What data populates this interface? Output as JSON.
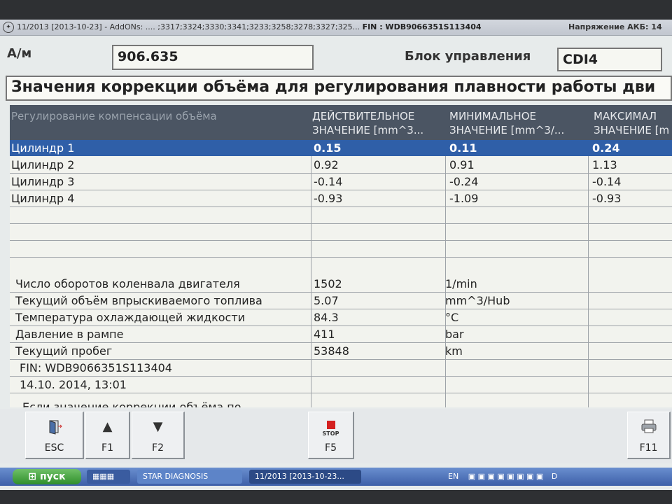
{
  "titlebar": {
    "app_info": "11/2013 [2013-10-23] - AddONs: .... ;3317;3324;3330;3341;3233;3258;3278;3327;325...",
    "fin": "FIN : WDB9066351S113404",
    "battery_label": "Напряжение АКБ: 14"
  },
  "header": {
    "model_label": "А/м",
    "model_value": "906.635",
    "ecu_label": "Блок управления",
    "ecu_value": "CDI4"
  },
  "subtitle": "Значения коррекции объёма для регулирования плавности работы дви",
  "table": {
    "headers": [
      "Регулирование компенсации объёма",
      "ДЕЙСТВИТЕЛЬНОЕ ЗНАЧЕНИЕ [mm^3...",
      "МИНИМАЛЬНОЕ ЗНАЧЕНИЕ [mm^3/...",
      "МАКСИМАЛ ЗНАЧЕНИЕ [m"
    ],
    "rows": [
      {
        "name": "Цилиндр 1",
        "actual": "0.15",
        "min": "0.11",
        "max": "0.24"
      },
      {
        "name": "Цилиндр 2",
        "actual": "0.92",
        "min": "0.91",
        "max": "1.13"
      },
      {
        "name": "Цилиндр 3",
        "actual": "-0.14",
        "min": "-0.24",
        "max": "-0.14"
      },
      {
        "name": "Цилиндр 4",
        "actual": "-0.93",
        "min": "-1.09",
        "max": "-0.93"
      }
    ],
    "params": [
      {
        "name": "Число оборотов коленвала двигателя",
        "value": "1502",
        "unit": "1/min"
      },
      {
        "name": "Текущий объём впрыскиваемого топлива",
        "value": "5.07",
        "unit": "mm^3/Hub"
      },
      {
        "name": "Температура охлаждающей жидкости",
        "value": "84.3",
        "unit": "°C"
      },
      {
        "name": "Давление в рампе",
        "value": "411",
        "unit": "bar"
      },
      {
        "name": "Текущий пробег",
        "value": "53848",
        "unit": "km"
      }
    ],
    "fin_line": "FIN: WDB9066351S113404",
    "datetime": "14.10. 2014, 13:01",
    "note": "Если значение коррекции объёма по"
  },
  "toolbar": {
    "esc": "ESC",
    "f1": "F1",
    "f2": "F2",
    "stop_icon_text": "STOP",
    "f5": "F5",
    "f11": "F11"
  },
  "taskbar": {
    "start": "пуск",
    "task1": "STAR DIAGNOSIS",
    "task2": "11/2013 [2013-10-23...",
    "lang": "EN",
    "tray_letter": "D"
  }
}
